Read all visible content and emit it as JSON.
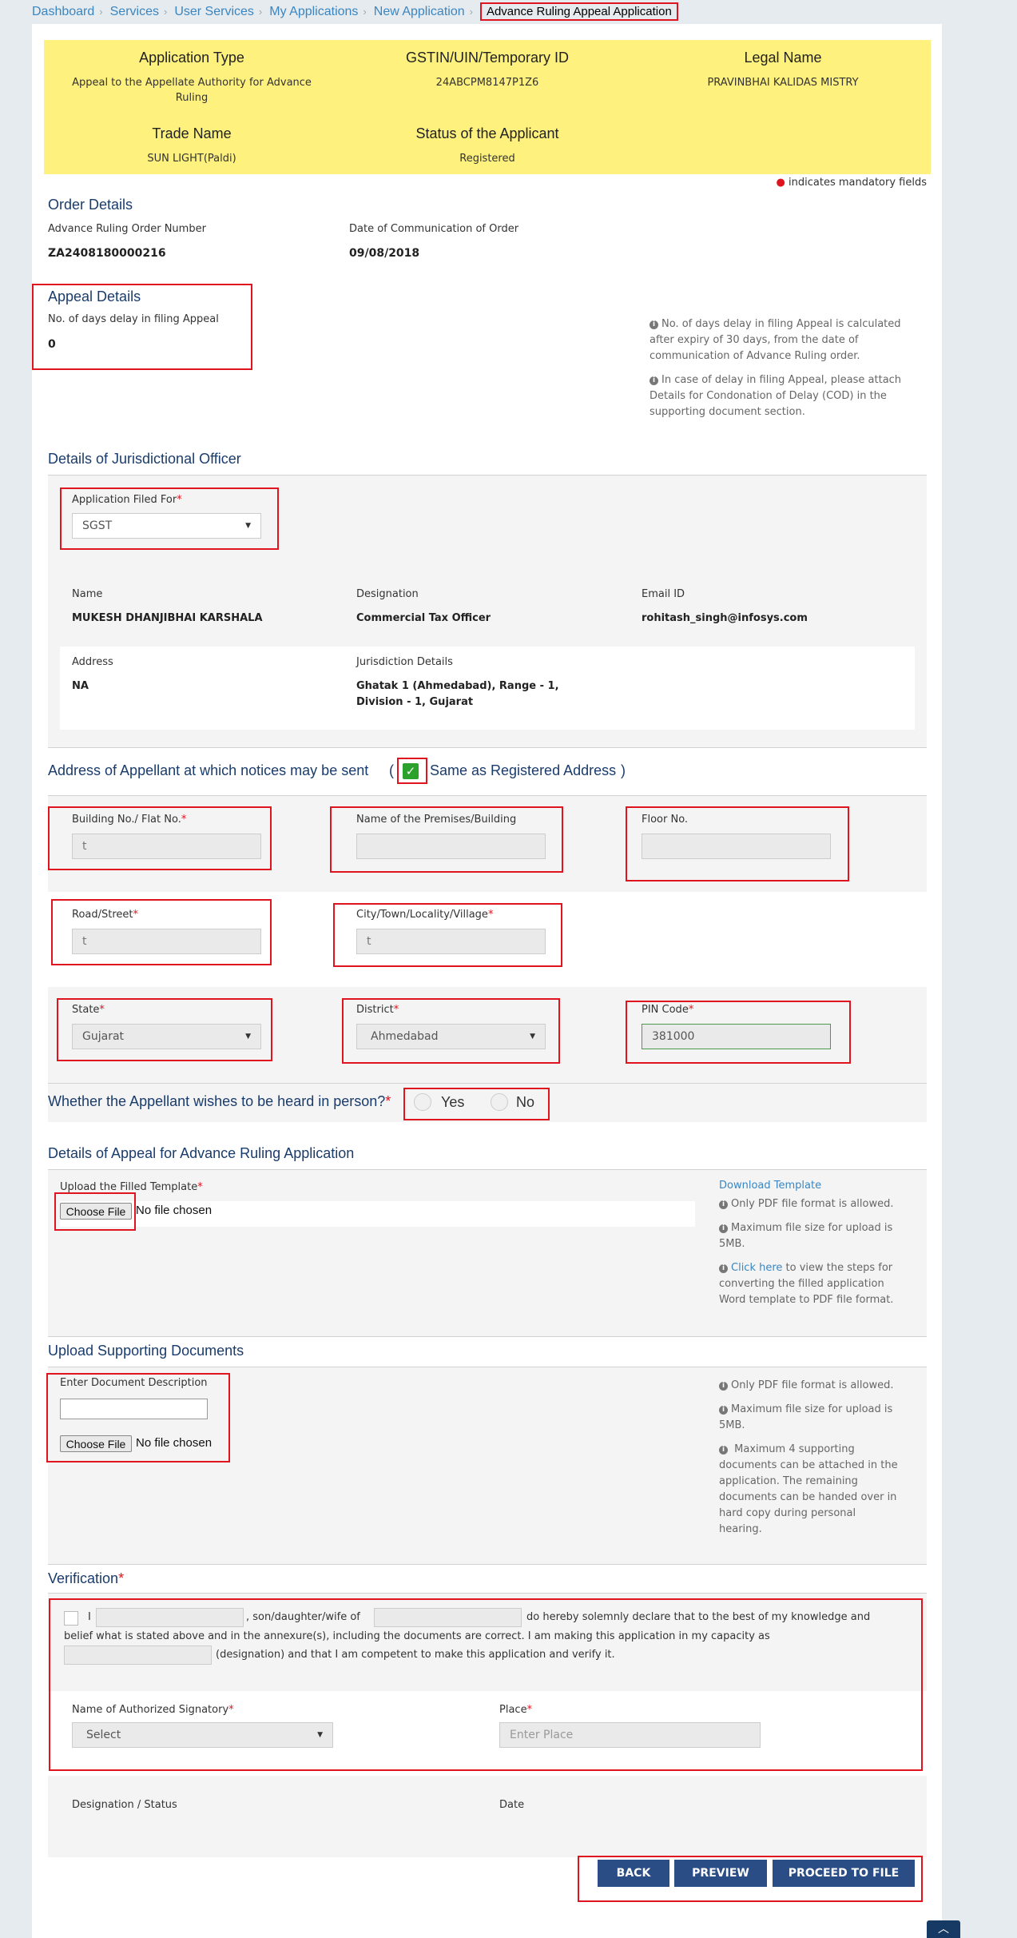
{
  "breadcrumb": {
    "items": [
      "Dashboard",
      "Services",
      "User Services",
      "My Applications",
      "New Application"
    ],
    "current": "Advance Ruling Appeal Application"
  },
  "summary": {
    "app_type_h": "Application Type",
    "app_type_v1": "Appeal to the Appellate Authority for Advance",
    "app_type_v2": "Ruling",
    "gstin_h": "GSTIN/UIN/Temporary ID",
    "gstin_v": "24ABCPM8147P1Z6",
    "legal_h": "Legal Name",
    "legal_v": "PRAVINBHAI KALIDAS MISTRY",
    "trade_h": "Trade Name",
    "trade_v": "SUN LIGHT(Paldi)",
    "status_h": "Status of the Applicant",
    "status_v": "Registered"
  },
  "mandatory": "indicates mandatory fields",
  "order": {
    "title": "Order Details",
    "num_label": "Advance Ruling Order Number",
    "num_value": "ZA2408180000216",
    "date_label": "Date of Communication of Order",
    "date_value": "09/08/2018"
  },
  "appeal": {
    "title": "Appeal Details",
    "delay_label": "No. of days delay in filing Appeal",
    "delay_value": "0",
    "note1_l1": "No. of days delay in filing Appeal is calculated",
    "note1_l2": "after expiry of 30 days, from the date of",
    "note1_l3": "communication of Advance Ruling order.",
    "note2_l1": "In case of delay in filing Appeal, please attach",
    "note2_l2": "Details for Condonation of Delay (COD) in the",
    "note2_l3": "supporting document section."
  },
  "juris": {
    "title": "Details of Jurisdictional Officer",
    "filed_for_label": "Application Filed For",
    "filed_for_value": "SGST",
    "name_label": "Name",
    "name_value": "MUKESH DHANJIBHAI KARSHALA",
    "desig_label": "Designation",
    "desig_value": "Commercial Tax Officer",
    "email_label": "Email ID",
    "email_value": "rohitash_singh@infosys.com",
    "addr_label": "Address",
    "addr_value": "NA",
    "jd_label": "Jurisdiction Details",
    "jd_value_l1": "Ghatak 1 (Ahmedabad), Range - 1,",
    "jd_value_l2": "Division - 1, Gujarat"
  },
  "address": {
    "title": "Address of Appellant at which notices may be sent",
    "paren_open": "(",
    "same_label": "Same as Registered Address",
    "paren_close": ")",
    "bld_label": "Building No./ Flat No.",
    "bld_value": "t",
    "prem_label": "Name of the Premises/Building",
    "prem_value": "",
    "floor_label": "Floor No.",
    "floor_value": "",
    "road_label": "Road/Street",
    "road_value": "t",
    "city_label": "City/Town/Locality/Village",
    "city_value": "t",
    "state_label": "State",
    "state_value": "Gujarat",
    "dist_label": "District",
    "dist_value": "Ahmedabad",
    "pin_label": "PIN Code",
    "pin_value": "381000"
  },
  "heard": {
    "question": "Whether the Appellant wishes to be heard in person?",
    "yes": "Yes",
    "no": "No"
  },
  "appeal_doc": {
    "title": "Details of Appeal for Advance Ruling Application",
    "upload_label": "Upload the Filled Template",
    "choose": "Choose File",
    "no_file": "No file chosen",
    "download": "Download Template",
    "n1": "Only PDF file format is allowed.",
    "n2_l1": "Maximum file size for upload is",
    "n2_l2": "5MB.",
    "n3_link": "Click here",
    "n3_l1": " to view the steps for",
    "n3_l2": "converting the filled application",
    "n3_l3": "Word template to PDF file format."
  },
  "support": {
    "title": "Upload Supporting Documents",
    "desc_label": "Enter Document Description",
    "choose": "Choose File",
    "no_file": "No file chosen",
    "n1": "Only PDF file format is allowed.",
    "n2_l1": "Maximum file size for upload is",
    "n2_l2": "5MB.",
    "n3_l1": "Maximum 4 supporting",
    "n3_l2": "documents can be attached in the",
    "n3_l3": "application. The remaining",
    "n3_l4": "documents can be handed over in",
    "n3_l5": "hard copy during personal",
    "n3_l6": "hearing."
  },
  "verify": {
    "title": "Verification",
    "i": "I",
    "sdw": ", son/daughter/wife of",
    "decl1": "do hereby solemnly declare that to the best of my knowledge and",
    "decl2": "belief what is stated above and in the annexure(s), including the documents are correct. I am making this application in my capacity as",
    "decl3": "(designation) and that I am competent to make this application and verify it.",
    "sig_label": "Name of Authorized Signatory",
    "sig_value": "Select",
    "place_label": "Place",
    "place_placeholder": "Enter Place",
    "desig_label": "Designation / Status",
    "date_label": "Date"
  },
  "buttons": {
    "back": "BACK",
    "preview": "PREVIEW",
    "proceed": "PROCEED TO FILE"
  }
}
